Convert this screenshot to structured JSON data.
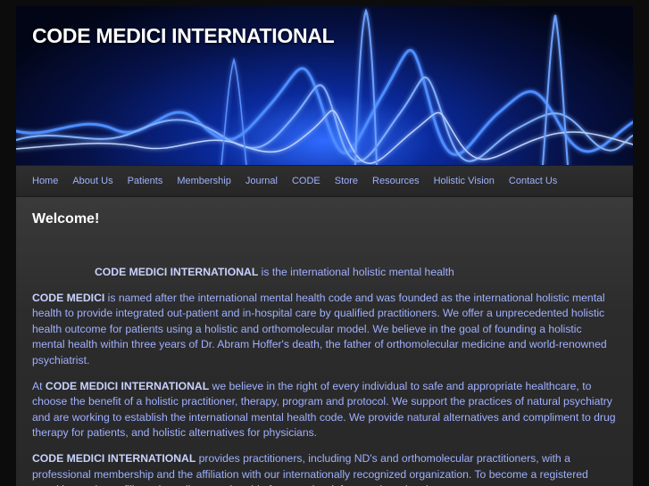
{
  "site_title": "CODE MEDICI INTERNATIONAL",
  "nav": [
    {
      "label": "Home"
    },
    {
      "label": "About Us"
    },
    {
      "label": "Patients"
    },
    {
      "label": "Membership"
    },
    {
      "label": "Journal"
    },
    {
      "label": "CODE"
    },
    {
      "label": "Store"
    },
    {
      "label": "Resources"
    },
    {
      "label": "Holistic Vision"
    },
    {
      "label": "Contact Us"
    }
  ],
  "content": {
    "heading": "Welcome!",
    "intro_bold": "CODE MEDICI INTERNATIONAL",
    "intro_text": " is the international holistic mental health",
    "p1_bold": "CODE MEDICI",
    "p1_text": " is named after the international mental health code and was founded as the international holistic mental health to provide integrated out-patient and in-hospital care by qualified practitioners.  We offer a unprecedented holistic health outcome for patients using a holistic and orthomolecular model. We believe in the goal of founding a holistic mental health within three years of Dr. Abram Hoffer's death, the father of orthomolecular medicine and world-renowned psychiatrist.",
    "p2_lead": "At ",
    "p2_bold": "CODE MEDICI INTERNATIONAL",
    "p2_text": " we believe in the right of every individual to safe and appropriate healthcare, to choose the benefit of a holistic practitioner, therapy, program and protocol. We support the practices of natural psychiatry and are working to establish the international mental health code. We provide natural alternatives and compliment to drug therapy for patients, and holistic alternatives for physicians.",
    "p3_bold": "CODE MEDICI INTERNATIONAL",
    "p3_text": " provides practitioners, including ND's and orthomolecular practitioners, with a professional membership and the affiliation with our internationally recognized organization. To become a registered practitioner please fill out the online membership form, and wait for your board review process."
  }
}
